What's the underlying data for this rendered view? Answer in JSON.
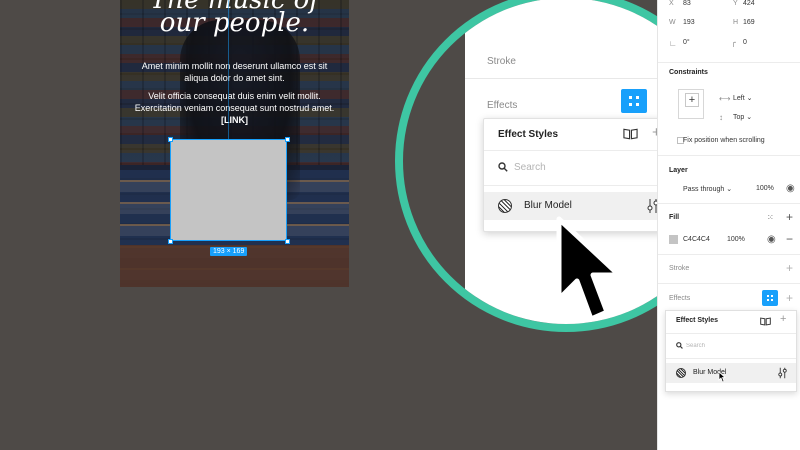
{
  "canvas": {
    "title_line1": "The music of",
    "title_line2": "our people.",
    "paragraph1": "Amet minim mollit non deserunt ullamco est sit aliqua dolor do amet sint.",
    "paragraph2": "Velit officia consequat duis enim velit mollit. Exercitation veniam consequat sunt nostrud amet.",
    "link_text": "[LINK]",
    "selection_size": "193 × 169",
    "selection_fill_color": "#c4c4c4"
  },
  "zoom": {
    "stroke_label": "Stroke",
    "effects_label": "Effects",
    "popup": {
      "title": "Effect Styles",
      "search_placeholder": "Search",
      "style_name": "Blur Model"
    }
  },
  "panel": {
    "x_label": "X",
    "x_value": "83",
    "y_label": "Y",
    "y_value": "424",
    "w_label": "W",
    "w_value": "193",
    "h_label": "H",
    "h_value": "169",
    "rotation_value": "0°",
    "radius_value": "0",
    "constraints_label": "Constraints",
    "constraint_h": "Left",
    "constraint_v": "Top",
    "fix_position_label": "Fix position when scrolling",
    "layer_label": "Layer",
    "blend_mode": "Pass through",
    "layer_opacity": "100%",
    "fill_label": "Fill",
    "fill_hex": "C4C4C4",
    "fill_opacity": "100%",
    "stroke_label": "Stroke",
    "effects_label": "Effects",
    "popup": {
      "title": "Effect Styles",
      "search_placeholder": "Search",
      "style_name": "Blur Model"
    }
  },
  "colors": {
    "accent_blue": "#18a0fb",
    "magnifier_ring": "#3ec6a3",
    "canvas_background": "#4e4a47"
  },
  "icons": [
    "search-icon",
    "book-icon",
    "plus-icon",
    "adjust-icon",
    "eye-icon",
    "minus-icon",
    "grid-icon",
    "style-swatch-icon",
    "cursor-icon"
  ]
}
